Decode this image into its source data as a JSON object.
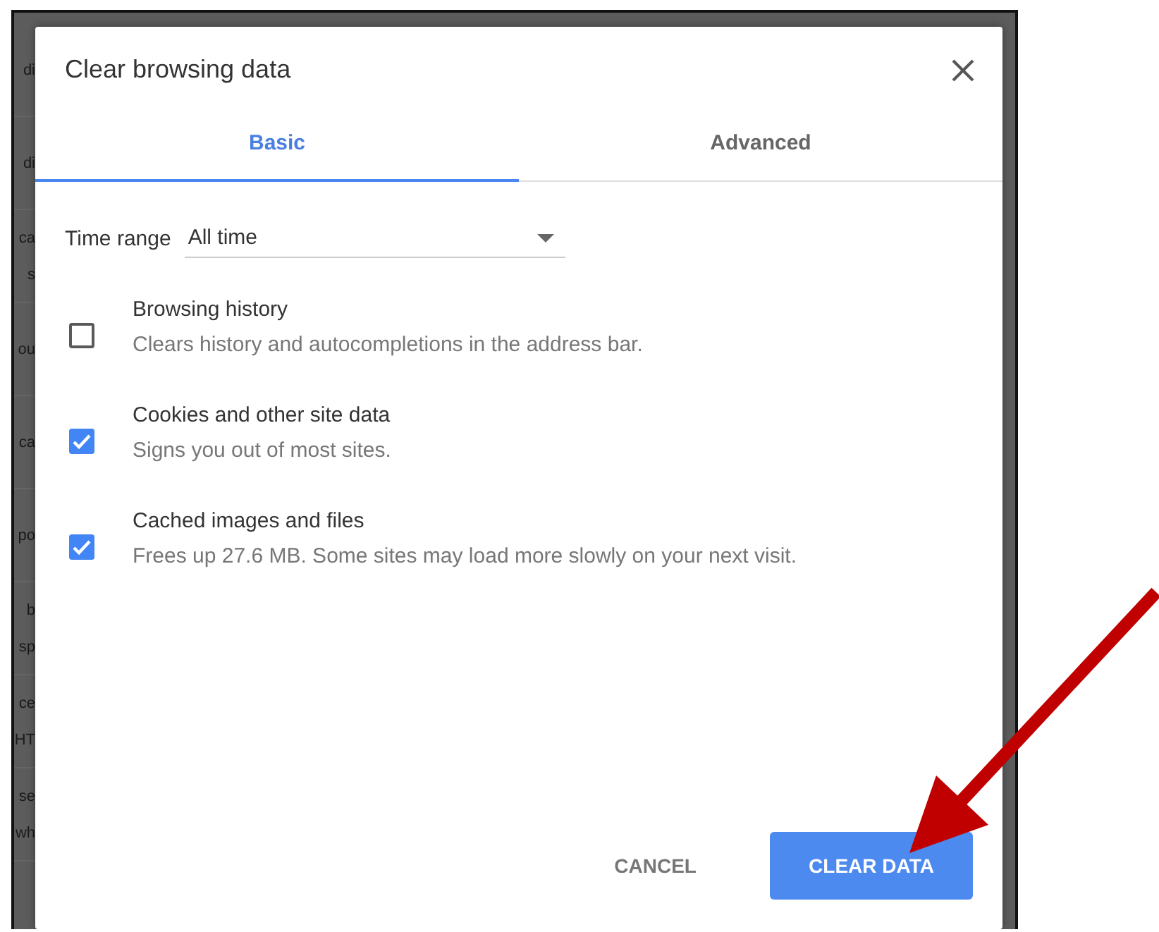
{
  "background_rows": [
    {
      "lines": [
        "di"
      ]
    },
    {
      "lines": [
        "di"
      ]
    },
    {
      "lines": [
        "ca",
        "s"
      ]
    },
    {
      "lines": [
        "ou"
      ]
    },
    {
      "lines": [
        "ca"
      ]
    },
    {
      "lines": [
        "po"
      ]
    },
    {
      "lines": [
        "b",
        "sp"
      ]
    },
    {
      "lines": [
        "ce",
        "HT"
      ]
    },
    {
      "lines": [
        "se",
        "wh"
      ]
    }
  ],
  "dialog": {
    "title": "Clear browsing data",
    "tabs": [
      {
        "label": "Basic",
        "selected": true
      },
      {
        "label": "Advanced",
        "selected": false
      }
    ],
    "time_range": {
      "label": "Time range",
      "value": "All time"
    },
    "options": [
      {
        "title": "Browsing history",
        "description": "Clears history and autocompletions in the address bar.",
        "checked": false
      },
      {
        "title": "Cookies and other site data",
        "description": "Signs you out of most sites.",
        "checked": true
      },
      {
        "title": "Cached images and files",
        "description": "Frees up 27.6 MB. Some sites may load more slowly on your next visit.",
        "checked": true
      }
    ],
    "buttons": [
      {
        "label": "CANCEL",
        "kind": "text"
      },
      {
        "label": "CLEAR DATA",
        "kind": "primary"
      }
    ]
  }
}
